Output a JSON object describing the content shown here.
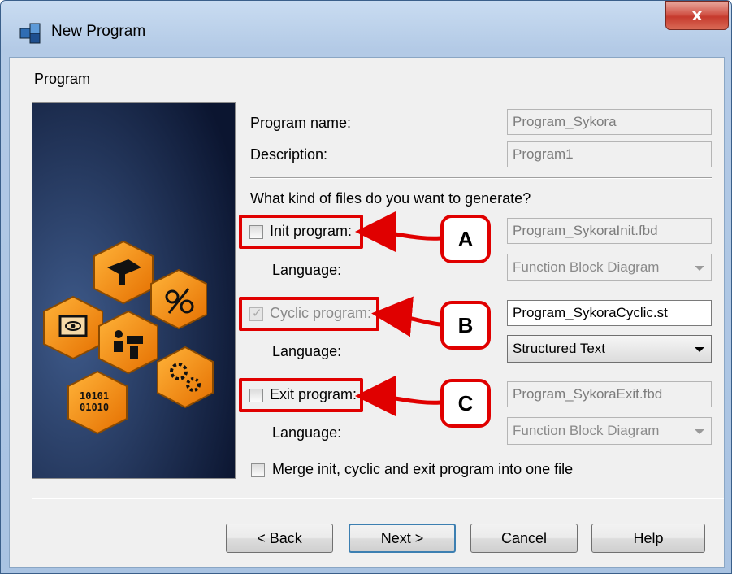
{
  "window": {
    "title": "New Program",
    "close_label": "x"
  },
  "section_title": "Program",
  "form": {
    "program_name_label": "Program name:",
    "program_name_value": "Program_Sykora",
    "description_label": "Description:",
    "description_value": "Program1",
    "question": "What kind of files do you want to generate?",
    "init": {
      "label": "Init program:",
      "checked": false,
      "file": "Program_SykoraInit.fbd",
      "language_label": "Language:",
      "language": "Function Block Diagram"
    },
    "cyclic": {
      "label": "Cyclic program:",
      "checked": true,
      "file": "Program_SykoraCyclic.st",
      "language_label": "Language:",
      "language": "Structured Text"
    },
    "exit": {
      "label": "Exit program:",
      "checked": false,
      "file": "Program_SykoraExit.fbd",
      "language_label": "Language:",
      "language": "Function Block Diagram"
    },
    "merge_label": "Merge init, cyclic and exit program into one file"
  },
  "callouts": {
    "a": "A",
    "b": "B",
    "c": "C"
  },
  "buttons": {
    "back": "< Back",
    "next": "Next >",
    "cancel": "Cancel",
    "help": "Help"
  },
  "colors": {
    "annotation_red": "#e00000",
    "banner_bg": "#0d1b35",
    "tile_orange": "#f08a0c"
  },
  "icons": [
    "app-blocks-icon",
    "graduation-cap-icon",
    "network-tools-icon",
    "eye-monitor-icon",
    "workers-icon",
    "binary-icon",
    "gears-icon"
  ]
}
